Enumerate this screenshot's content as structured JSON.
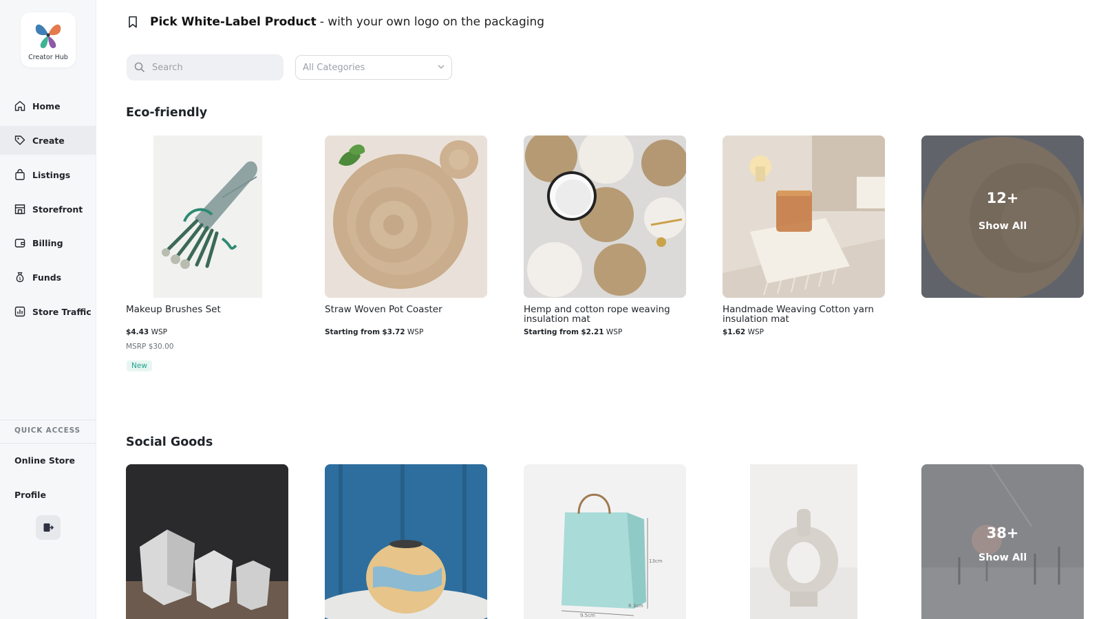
{
  "app": {
    "logo_text": "Creator Hub"
  },
  "sidebar": {
    "items": [
      {
        "label": "Home",
        "icon": "home-icon"
      },
      {
        "label": "Create",
        "icon": "tag-icon",
        "active": true
      },
      {
        "label": "Listings",
        "icon": "bag-icon"
      },
      {
        "label": "Storefront",
        "icon": "storefront-icon"
      },
      {
        "label": "Billing",
        "icon": "wallet-icon"
      },
      {
        "label": "Funds",
        "icon": "money-bag-icon"
      },
      {
        "label": "Store Traffic",
        "icon": "bar-chart-icon"
      }
    ],
    "quick_access_label": "QUICK ACCESS",
    "quick_access": [
      {
        "label": "Online Store"
      },
      {
        "label": "Profile"
      }
    ],
    "logout_icon": "logout-icon"
  },
  "header": {
    "title_bold": "Pick White-Label Product",
    "title_rest": "- with your own logo on the packaging"
  },
  "filters": {
    "search_placeholder": "Search",
    "search_value": "",
    "category_selected": "All Categories"
  },
  "sections": [
    {
      "title": "Eco-friendly",
      "products": [
        {
          "name": "Makeup Brushes Set",
          "price": "$4.43",
          "price_suffix": "WSP",
          "msrp": "MSRP $30.00",
          "badge": "New"
        },
        {
          "name": "Straw Woven Pot Coaster",
          "price_prefix": "Starting from",
          "price": "$3.72",
          "price_suffix": "WSP"
        },
        {
          "name": "Hemp and cotton rope weaving insulation mat",
          "price_prefix": "Starting from",
          "price": "$2.21",
          "price_suffix": "WSP"
        },
        {
          "name": "Handmade Weaving Cotton yarn insulation mat",
          "price": "$1.62",
          "price_suffix": "WSP"
        }
      ],
      "show_all": {
        "count": "12+",
        "label": "Show All"
      }
    },
    {
      "title": "Social Goods",
      "products": [
        {},
        {},
        {},
        {}
      ],
      "show_all": {
        "count": "38+",
        "label": "Show All"
      }
    }
  ],
  "colors": {
    "accent_new": "#23a08a",
    "sidebar_bg": "#f6f7f9",
    "active_bg": "#ebecef"
  }
}
